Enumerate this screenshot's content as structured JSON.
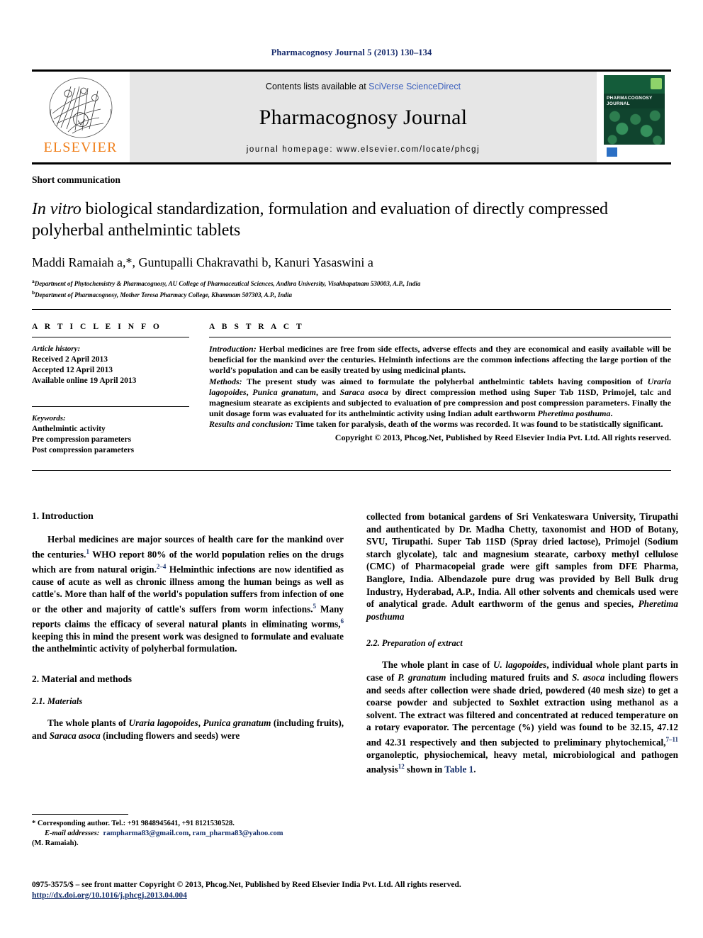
{
  "running_head": "Pharmacognosy Journal 5 (2013) 130–134",
  "masthead": {
    "publisher_logo_name": "elsevier-tree-logo",
    "publisher_wordmark": "ELSEVIER",
    "contents_prefix": "Contents lists available at ",
    "contents_link": "SciVerse ScienceDirect",
    "journal_title": "Pharmacognosy Journal",
    "homepage": "journal homepage: www.elsevier.com/locate/phcgj",
    "cover_title": "PHARMACOGNOSY JOURNAL"
  },
  "article": {
    "kind": "Short communication",
    "title_italic_lead": "In vitro",
    "title_rest": " biological standardization, formulation and evaluation of directly compressed polyherbal anthelmintic tablets",
    "authors_plain": "Maddi Ramaiah a,*, Guntupalli Chakravathi b, Kanuri Yasaswini a",
    "affiliation_a": "Department of Phytochemistry & Pharmacognosy, AU College of Pharmaceutical Sciences, Andhra University, Visakhapatnam 530003, A.P., India",
    "affiliation_b": "Department of Pharmacognosy, Mother Teresa Pharmacy College, Khammam 507303, A.P., India"
  },
  "article_info": {
    "heading": "A R T I C L E   I N F O",
    "history_label": "Article history:",
    "history": [
      "Received 2 April 2013",
      "Accepted 12 April 2013",
      "Available online 19 April 2013"
    ],
    "keywords_label": "Keywords:",
    "keywords": [
      "Anthelmintic activity",
      "Pre compression parameters",
      "Post compression parameters"
    ]
  },
  "abstract": {
    "heading": "A B S T R A C T",
    "introduction_label": "Introduction:",
    "introduction_text": " Herbal medicines are free from side effects, adverse effects and they are economical and easily available will be beneficial for the mankind over the centuries. Helminth infections are the common infections affecting the large portion of the world's population and can be easily treated by using medicinal plants.",
    "methods_label": "Methods:",
    "methods_text_1": " The present study was aimed to formulate the polyherbal anthelmintic tablets having composition of ",
    "methods_sp1": "Uraria lagopoides",
    "methods_text_2": ", ",
    "methods_sp2": "Punica granatum",
    "methods_text_3": ", and ",
    "methods_sp3": "Saraca asoca",
    "methods_text_4": " by direct compression method using Super Tab 11SD, Primojel, talc and magnesium stearate as excipients and subjected to evaluation of pre compression and post compression parameters. Finally the unit dosage form was evaluated for its anthelmintic activity using Indian adult earthworm ",
    "methods_sp4": "Pheretima posthuma",
    "methods_text_5": ".",
    "results_label": "Results and conclusion:",
    "results_text": " Time taken for paralysis, death of the worms was recorded. It was found to be statistically significant.",
    "copyright": "Copyright © 2013, Phcog.Net, Published by Reed Elsevier India Pvt. Ltd. All rights reserved."
  },
  "body": {
    "left": {
      "h1_intro": "1.  Introduction",
      "intro_p1_a": "Herbal medicines are major sources of health care for the mankind over the centuries.",
      "intro_p1_r1": "1",
      "intro_p1_b": " WHO report 80% of the world population relies on the drugs which are from natural origin.",
      "intro_p1_r2": "2–4",
      "intro_p1_c": " Helminthic infections are now identified as cause of acute as well as chronic illness among the human beings as well as cattle's. More than half of the world's population suffers from infection of one or the other and majority of cattle's suffers from worm infections.",
      "intro_p1_r3": "5",
      "intro_p1_d": " Many reports claims the efficacy of several natural plants in eliminating worms,",
      "intro_p1_r4": "6",
      "intro_p1_e": " keeping this in mind the present work was designed to formulate and evaluate the anthelmintic activity of polyherbal formulation.",
      "h2_material": "2.  Material and methods",
      "h3_materials": "2.1.  Materials",
      "materials_a": "The whole plants of ",
      "materials_sp1": "Uraria lagopoides",
      "materials_b": ", ",
      "materials_sp2": "Punica granatum",
      "materials_c": " (including fruits), and ",
      "materials_sp3": "Saraca asoca",
      "materials_d": " (including flowers and seeds) were"
    },
    "right": {
      "cont_p1": "collected from botanical gardens of Sri Venkateswara University, Tirupathi and authenticated by Dr. Madha Chetty, taxonomist and HOD of Botany, SVU, Tirupathi. Super Tab 11SD (Spray dried lactose), Primojel (Sodium starch glycolate), talc and magnesium stearate, carboxy methyl cellulose (CMC) of Pharmacopeial grade were gift samples from DFE Pharma, Banglore, India. Albendazole pure drug was provided by Bell Bulk drug Industry, Hyderabad, A.P., India. All other solvents and chemicals used were of analytical grade. Adult earthworm of the genus and species, ",
      "cont_p1_sp": "Pheretima posthuma",
      "h3_extract": "2.2.  Preparation of extract",
      "extract_a": "The whole plant in case of ",
      "extract_sp1": "U. lagopoides",
      "extract_b": ", individual whole plant parts in case of ",
      "extract_sp2": "P. granatum",
      "extract_c": " including matured fruits and ",
      "extract_sp3": "S. asoca",
      "extract_d": " including flowers and seeds after collection were shade dried, powdered (40 mesh size) to get a coarse powder and subjected to Soxhlet extraction using methanol as a solvent. The extract was filtered and concentrated at reduced temperature on a rotary evaporator. The percentage (%) yield was found to be 32.15, 47.12 and 42.31 respectively and then subjected to preliminary phytochemical,",
      "extract_r1": "7–11",
      "extract_e": " organoleptic, physiochemical, heavy metal, microbiological and pathogen analysis",
      "extract_r2": "12",
      "extract_f": " shown in ",
      "extract_link": "Table 1",
      "extract_g": "."
    }
  },
  "footnote": {
    "corresponding": "* Corresponding author. Tel.: +91 9848945641, +91 8121530528.",
    "email_label": "E-mail addresses:",
    "email_1": "rampharma83@gmail.com",
    "email_sep": ",  ",
    "email_2": "ram_pharma83@yahoo.com",
    "email_owner": "(M. Ramaiah)."
  },
  "footer": {
    "issn_line": "0975-3575/$ – see front matter Copyright © 2013, Phcog.Net, Published by Reed Elsevier India Pvt. Ltd. All rights reserved.",
    "doi": "http://dx.doi.org/10.1016/j.phcgj.2013.04.004"
  },
  "colors": {
    "header_blue": "#1a2e6e",
    "link_blue": "#16306b",
    "sciencedirect_blue": "#3b5fbd",
    "elsevier_orange": "#f07f1a",
    "masthead_gray": "#e6e6e6"
  }
}
